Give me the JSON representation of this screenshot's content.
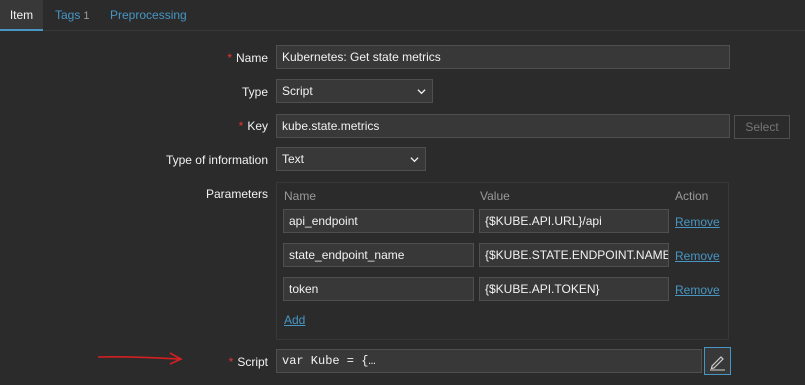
{
  "tabs": {
    "item": "Item",
    "tags": "Tags",
    "tags_count": "1",
    "preprocessing": "Preprocessing"
  },
  "required_mark": "*",
  "fields": {
    "name": {
      "label": "Name",
      "value": "Kubernetes: Get state metrics"
    },
    "type": {
      "label": "Type",
      "value": "Script"
    },
    "key": {
      "label": "Key",
      "value": "kube.state.metrics",
      "select_button": "Select"
    },
    "type_of_information": {
      "label": "Type of information",
      "value": "Text"
    },
    "parameters": {
      "label": "Parameters",
      "columns": {
        "name": "Name",
        "value": "Value",
        "action": "Action"
      },
      "rows": [
        {
          "name": "api_endpoint",
          "value": "{$KUBE.API.URL}/api",
          "action": "Remove"
        },
        {
          "name": "state_endpoint_name",
          "value": "{$KUBE.STATE.ENDPOINT.NAME}",
          "action": "Remove"
        },
        {
          "name": "token",
          "value": "{$KUBE.API.TOKEN}",
          "action": "Remove"
        }
      ],
      "add": "Add"
    },
    "script": {
      "label": "Script",
      "value": "var Kube = {…"
    }
  },
  "colors": {
    "background": "#2b2b2b",
    "input_bg": "#383838",
    "accent": "#4796c4",
    "required": "#e33734",
    "annotation_arrow": "#d42020"
  },
  "icons": [
    "chevron-down-icon",
    "pencil-icon",
    "red-arrow-annotation"
  ]
}
